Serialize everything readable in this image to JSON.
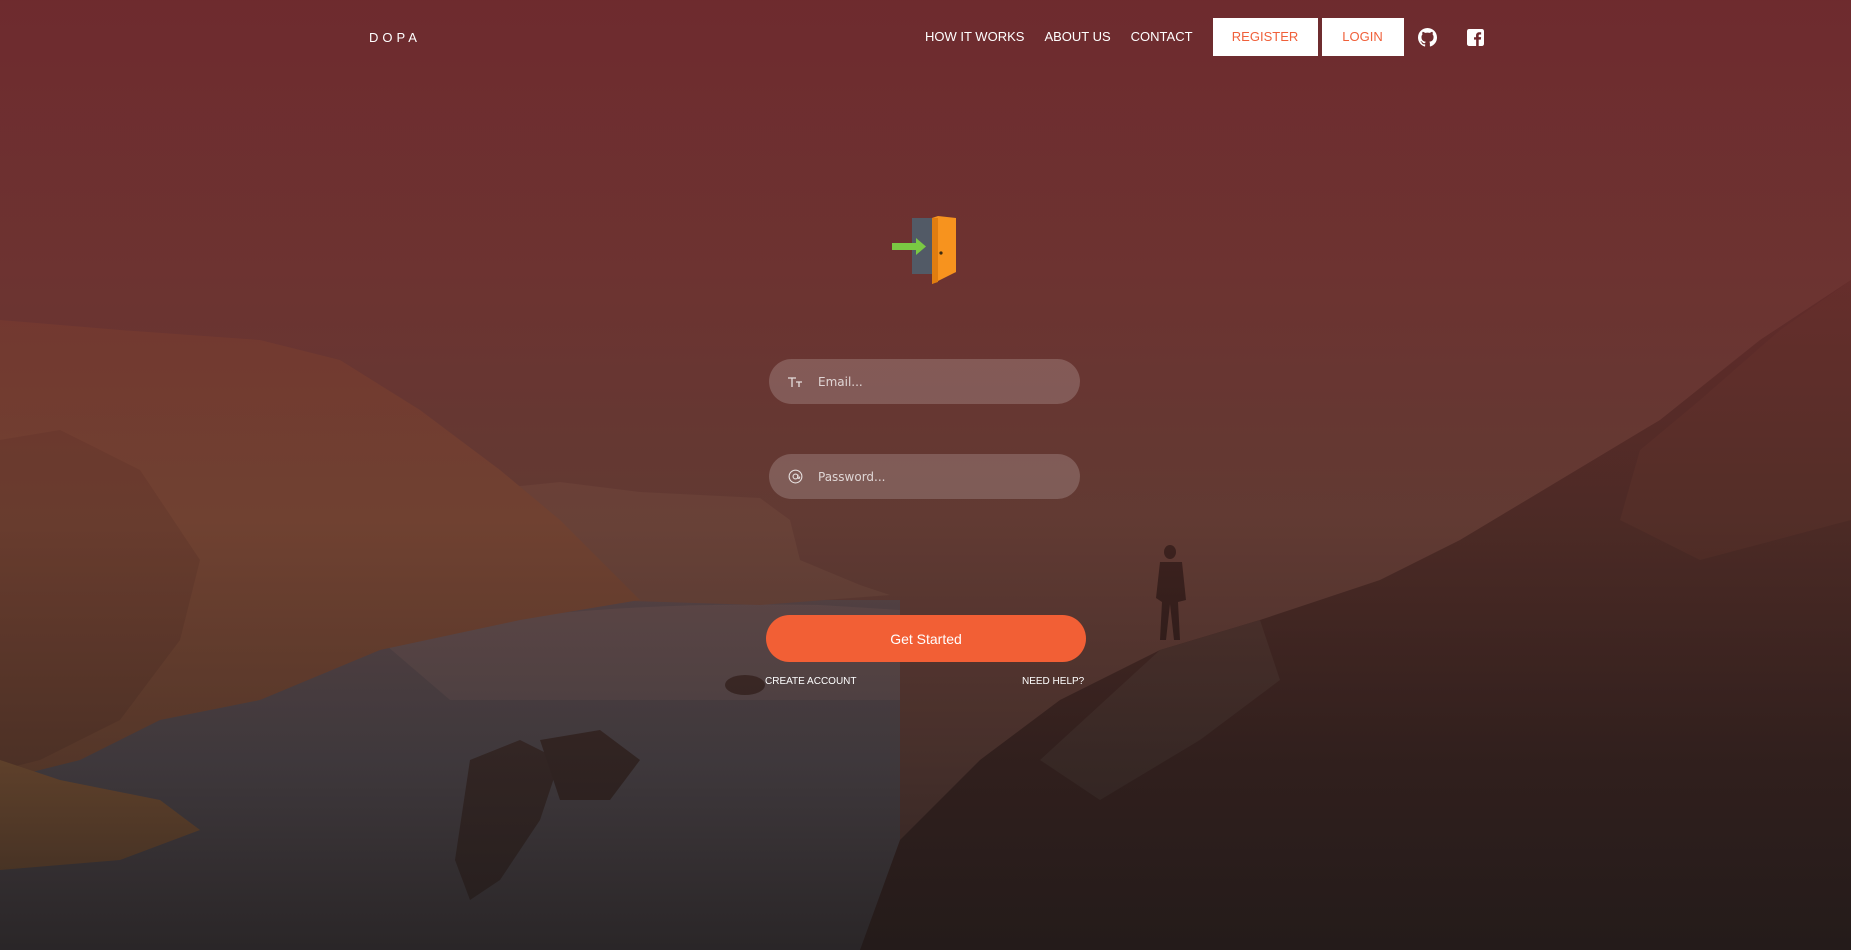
{
  "header": {
    "brand": "DOPA",
    "nav": [
      "HOW IT WORKS",
      "ABOUT US",
      "CONTACT"
    ],
    "register_label": "REGISTER",
    "login_label": "LOGIN",
    "social_icons": [
      "github-icon",
      "facebook-icon"
    ]
  },
  "login_form": {
    "logo_icon": "door-entry-icon",
    "email": {
      "placeholder": "Email...",
      "value": "",
      "icon": "text-icon"
    },
    "password": {
      "placeholder": "Password...",
      "value": "",
      "icon": "at-sign-icon"
    },
    "submit_label": "Get Started",
    "create_account_label": "CREATE ACCOUNT",
    "need_help_label": "NEED HELP?"
  },
  "colors": {
    "accent": "#f25f35",
    "overlay": "#6e282d",
    "door": "#f7931e",
    "arrow": "#7ac943"
  }
}
